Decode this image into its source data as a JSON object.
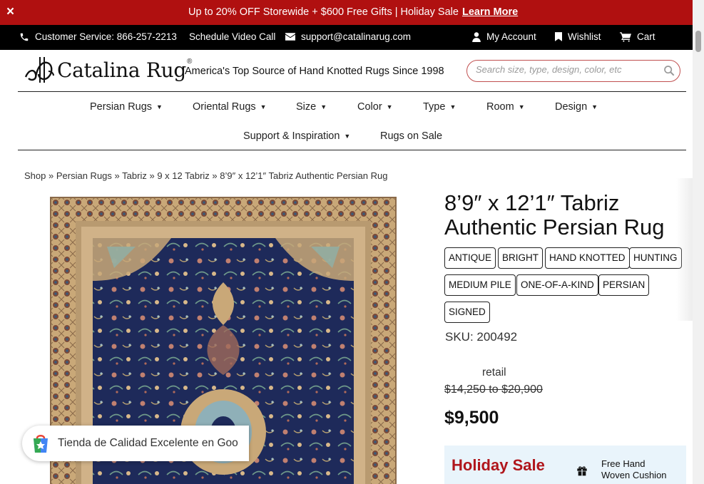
{
  "promo": {
    "close_icon": "×",
    "message": "Up to 20% OFF Storewide + $600 Free Gifts | Holiday Sale",
    "link": "Learn More"
  },
  "topbar": {
    "customer_service": "Customer Service: 866-257-2213",
    "video_call": "Schedule Video Call",
    "email": "support@catalinarug.com",
    "account": "My Account",
    "wishlist": "Wishlist",
    "cart": "Cart"
  },
  "header": {
    "logo_text": "Catalina Rug",
    "logo_reg": "®",
    "tagline": "America's Top Source of Hand Knotted Rugs Since 1998",
    "search_placeholder": "Search size, type, design, color, etc"
  },
  "nav": {
    "items": [
      {
        "label": "Persian Rugs",
        "caret": "▼"
      },
      {
        "label": "Oriental Rugs",
        "caret": "▼"
      },
      {
        "label": "Size",
        "caret": "▼"
      },
      {
        "label": "Color",
        "caret": "▼"
      },
      {
        "label": "Type",
        "caret": "▼"
      },
      {
        "label": "Room",
        "caret": "▼"
      },
      {
        "label": "Design",
        "caret": "▼"
      },
      {
        "label": "Support & Inspiration",
        "caret": "▼"
      },
      {
        "label": "Rugs on Sale",
        "caret": ""
      }
    ]
  },
  "breadcrumb": {
    "items": [
      "Shop",
      "Persian Rugs",
      "Tabriz",
      "9 x 12 Tabriz",
      "8’9″ x 12’1″ Tabriz Authentic Persian Rug"
    ],
    "separator": "»"
  },
  "product": {
    "title": "8’9″ x 12’1″ Tabriz Authentic Persian Rug",
    "tags": [
      "ANTIQUE",
      "BRIGHT",
      "HAND KNOTTED",
      "HUNTING",
      "MEDIUM PILE",
      "ONE-OF-A-KIND",
      "PERSIAN",
      "SIGNED"
    ],
    "sku": "SKU: 200492",
    "retail_label": "retail",
    "retail_range": "$14,250 to $20,900",
    "price": "$9,500"
  },
  "holiday": {
    "title": "Holiday Sale",
    "gift_line1": "Free Hand",
    "gift_line2": "Woven Cushion"
  },
  "google_badge": {
    "text": "Tienda de Calidad Excelente en Goo"
  },
  "colors": {
    "promo_red": "#b01010",
    "holiday_red": "#b0161c",
    "rug_navy": "#1e2a5a",
    "rug_gold": "#c9a878",
    "holiday_bg": "#e9f4fb"
  }
}
